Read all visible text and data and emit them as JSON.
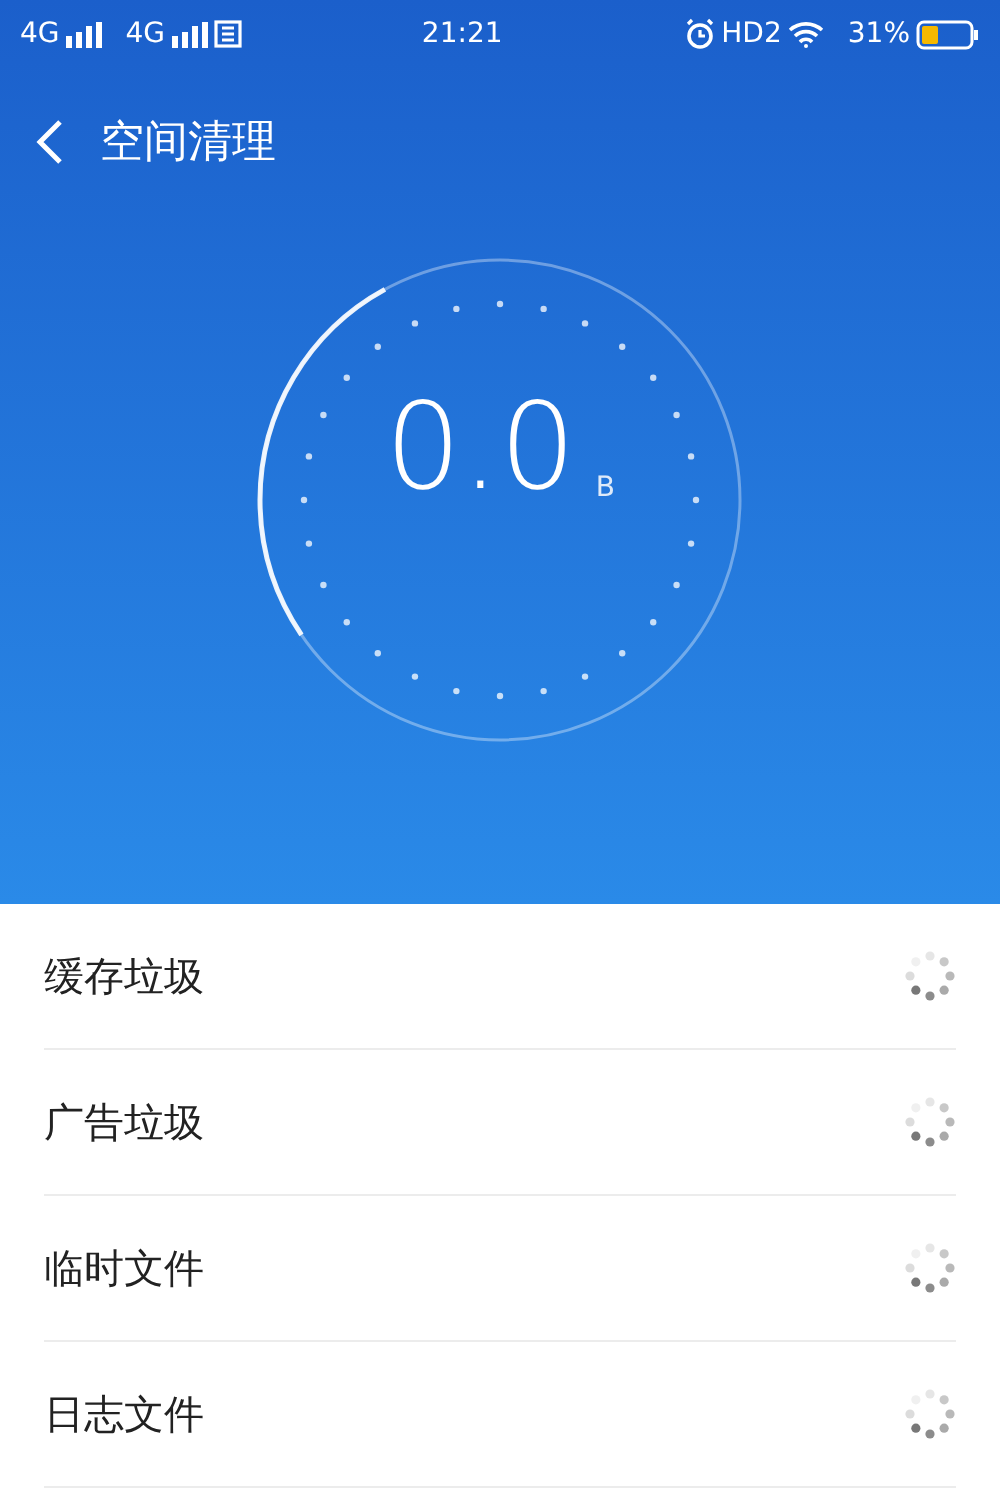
{
  "status_bar": {
    "sim1": "4G",
    "sim2": "4G",
    "time": "21:21",
    "hd": "HD2",
    "battery": "31%"
  },
  "header": {
    "title": "空间清理"
  },
  "gauge": {
    "value": "0.0",
    "unit": "B"
  },
  "items": [
    {
      "label": "缓存垃圾"
    },
    {
      "label": "广告垃圾"
    },
    {
      "label": "临时文件"
    },
    {
      "label": "日志文件"
    }
  ]
}
